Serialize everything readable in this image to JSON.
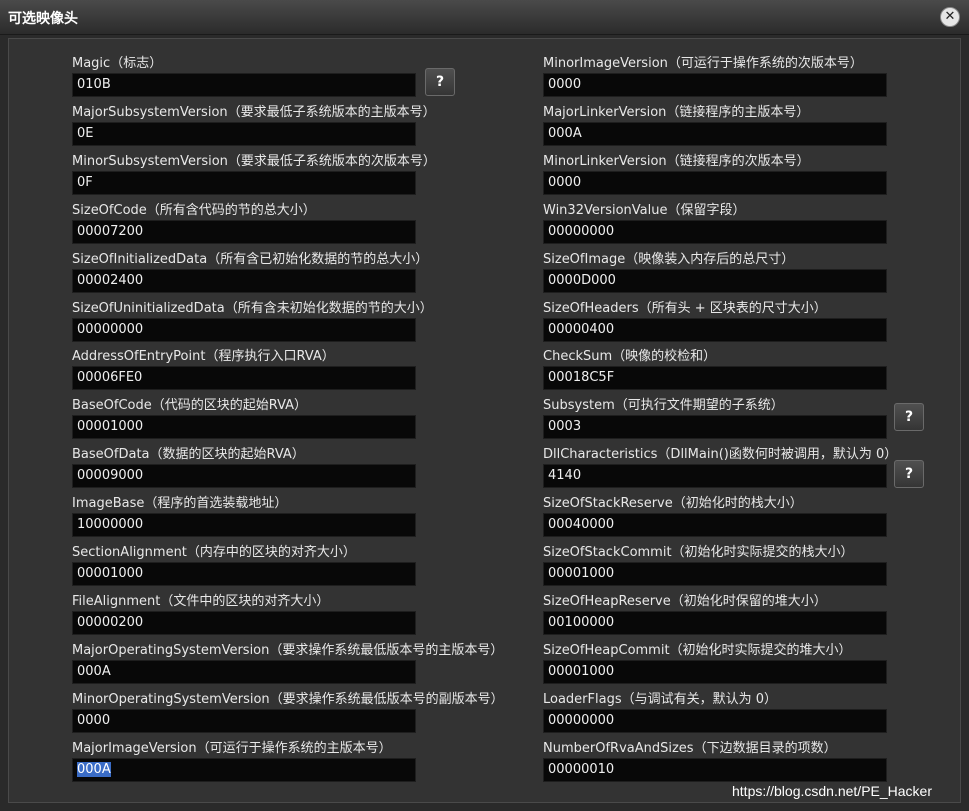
{
  "window": {
    "title": "可选映像头",
    "close_icon": "close-icon"
  },
  "help_label": "?",
  "left_fields": [
    {
      "label": "Magic（标志）",
      "value": "010B"
    },
    {
      "label": "MajorSubsystemVersion（要求最低子系统版本的主版本号）",
      "value": "0E"
    },
    {
      "label": "MinorSubsystemVersion（要求最低子系统版本的次版本号）",
      "value": "0F"
    },
    {
      "label": "SizeOfCode（所有含代码的节的总大小）",
      "value": "00007200"
    },
    {
      "label": "SizeOfInitializedData（所有含已初始化数据的节的总大小）",
      "value": "00002400"
    },
    {
      "label": "SizeOfUninitializedData（所有含未初始化数据的节的大小）",
      "value": "00000000"
    },
    {
      "label": "AddressOfEntryPoint（程序执行入口RVA）",
      "value": "00006FE0"
    },
    {
      "label": "BaseOfCode（代码的区块的起始RVA）",
      "value": "00001000"
    },
    {
      "label": "BaseOfData（数据的区块的起始RVA）",
      "value": "00009000"
    },
    {
      "label": "ImageBase（程序的首选装载地址）",
      "value": "10000000"
    },
    {
      "label": "SectionAlignment（内存中的区块的对齐大小）",
      "value": "00001000"
    },
    {
      "label": "FileAlignment（文件中的区块的对齐大小）",
      "value": "00000200"
    },
    {
      "label": "MajorOperatingSystemVersion（要求操作系统最低版本号的主版本号）",
      "value": "000A"
    },
    {
      "label": "MinorOperatingSystemVersion（要求操作系统最低版本号的副版本号）",
      "value": "0000"
    },
    {
      "label": "MajorImageVersion（可运行于操作系统的主版本号）",
      "value": "000A"
    }
  ],
  "right_fields": [
    {
      "label": "MinorImageVersion（可运行于操作系统的次版本号）",
      "value": "0000"
    },
    {
      "label": "MajorLinkerVersion（链接程序的主版本号）",
      "value": "000A"
    },
    {
      "label": "MinorLinkerVersion（链接程序的次版本号）",
      "value": "0000"
    },
    {
      "label": "Win32VersionValue（保留字段）",
      "value": "00000000"
    },
    {
      "label": "SizeOfImage（映像装入内存后的总尺寸）",
      "value": "0000D000"
    },
    {
      "label": "SizeOfHeaders（所有头 + 区块表的尺寸大小）",
      "value": "00000400"
    },
    {
      "label": "CheckSum（映像的校检和）",
      "value": "00018C5F"
    },
    {
      "label": "Subsystem（可执行文件期望的子系统）",
      "value": "0003"
    },
    {
      "label": "DllCharacteristics（DllMain()函数何时被调用，默认为 0）",
      "value": "4140"
    },
    {
      "label": "SizeOfStackReserve（初始化时的栈大小）",
      "value": "00040000"
    },
    {
      "label": "SizeOfStackCommit（初始化时实际提交的栈大小）",
      "value": "00001000"
    },
    {
      "label": "SizeOfHeapReserve（初始化时保留的堆大小）",
      "value": "00100000"
    },
    {
      "label": "SizeOfHeapCommit（初始化时实际提交的堆大小）",
      "value": "00001000"
    },
    {
      "label": "LoaderFlags（与调试有关，默认为 0）",
      "value": "00000000"
    },
    {
      "label": "NumberOfRvaAndSizes（下边数据目录的项数）",
      "value": "00000010"
    }
  ],
  "watermark": "https://blog.csdn.net/PE_Hacker"
}
